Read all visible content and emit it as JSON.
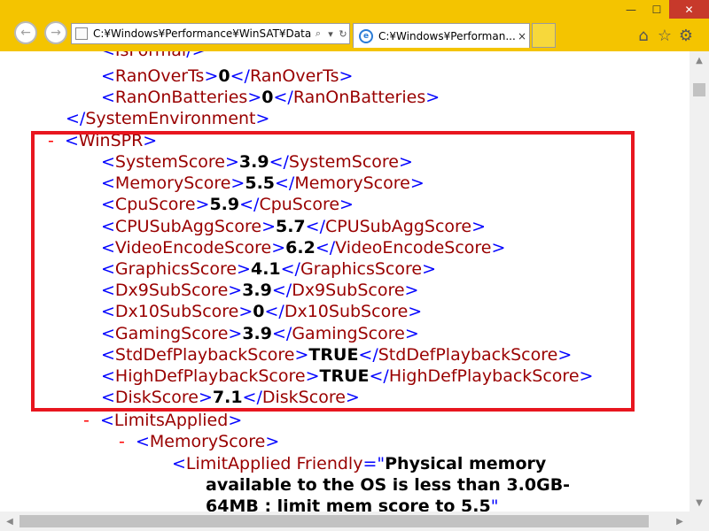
{
  "browser": {
    "address": "C:¥Windows¥Performance¥WinSAT¥Data",
    "tab_title": "C:¥Windows¥Performan...",
    "tab_close": "×",
    "back_glyph": "←",
    "forward_glyph": "→",
    "search_glyph": "⌕",
    "dropdown_glyph": "▾",
    "refresh_glyph": "↻",
    "tab_icon_glyph": "e",
    "minimize_glyph": "—",
    "maximize_glyph": "☐",
    "close_glyph": "✕",
    "home_glyph": "⌂",
    "star_glyph": "☆",
    "gear_glyph": "⚙",
    "scroll_up": "▲",
    "scroll_down": "▼",
    "scroll_left": "◀",
    "scroll_right": "▶"
  },
  "xml": {
    "lt": "<",
    "gt": ">",
    "close_lt": "</",
    "self_close": "/>",
    "dash": "-",
    "isformal_tag": "IsFormal",
    "ranoverts": {
      "tag": "RanOverTs",
      "value": "0"
    },
    "ranonbatteries": {
      "tag": "RanOnBatteries",
      "value": "0"
    },
    "systemenv_tag": "SystemEnvironment",
    "winspr_tag": "WinSPR",
    "scores": [
      {
        "tag": "SystemScore",
        "value": "3.9"
      },
      {
        "tag": "MemoryScore",
        "value": "5.5"
      },
      {
        "tag": "CpuScore",
        "value": "5.9"
      },
      {
        "tag": "CPUSubAggScore",
        "value": "5.7"
      },
      {
        "tag": "VideoEncodeScore",
        "value": "6.2"
      },
      {
        "tag": "GraphicsScore",
        "value": "4.1"
      },
      {
        "tag": "Dx9SubScore",
        "value": "3.9"
      },
      {
        "tag": "Dx10SubScore",
        "value": "0"
      },
      {
        "tag": "GamingScore",
        "value": "3.9"
      },
      {
        "tag": "StdDefPlaybackScore",
        "value": "TRUE"
      },
      {
        "tag": "HighDefPlaybackScore",
        "value": "TRUE"
      },
      {
        "tag": "DiskScore",
        "value": "7.1"
      }
    ],
    "limitsapplied_tag": "LimitsApplied",
    "memoryscore_tag": "MemoryScore",
    "limitapplied": {
      "tag": "LimitApplied",
      "attr": "Friendly",
      "eq": "=",
      "quote": "\"",
      "text_line1": "Physical memory",
      "text_line2": "available to the OS is less than 3.0GB-",
      "text_line3": "64MB : limit mem score to 5.5"
    }
  },
  "colors": {
    "chrome": "#f4c400",
    "highlight": "#e8161f",
    "tag_bracket": "#0000ff",
    "tag_name": "#990000"
  }
}
